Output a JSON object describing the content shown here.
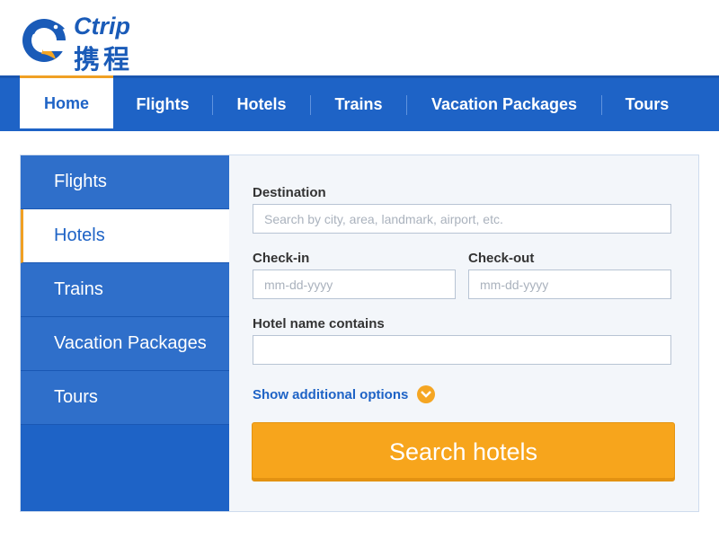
{
  "logo": {
    "brand_en": "Ctrip",
    "brand_cn": "携程",
    "icon": "dolphin-icon"
  },
  "topnav": {
    "items": [
      {
        "label": "Home",
        "active": true
      },
      {
        "label": "Flights",
        "active": false
      },
      {
        "label": "Hotels",
        "active": false
      },
      {
        "label": "Trains",
        "active": false
      },
      {
        "label": "Vacation Packages",
        "active": false
      },
      {
        "label": "Tours",
        "active": false
      }
    ]
  },
  "sidebar": {
    "items": [
      {
        "label": "Flights",
        "active": false
      },
      {
        "label": "Hotels",
        "active": true
      },
      {
        "label": "Trains",
        "active": false
      },
      {
        "label": "Vacation Packages",
        "active": false
      },
      {
        "label": "Tours",
        "active": false
      }
    ]
  },
  "form": {
    "destination_label": "Destination",
    "destination_placeholder": "Search by city, area, landmark, airport, etc.",
    "checkin_label": "Check-in",
    "checkin_placeholder": "mm-dd-yyyy",
    "checkout_label": "Check-out",
    "checkout_placeholder": "mm-dd-yyyy",
    "hotel_name_label": "Hotel name contains",
    "hotel_name_value": "",
    "more_options_label": "Show additional options",
    "more_options_icon": "chevron-down-circle-icon",
    "search_button_label": "Search hotels"
  },
  "colors": {
    "brand_blue": "#1e63c6",
    "accent_orange": "#f7a51c",
    "panel_bg": "#f3f6fa"
  }
}
